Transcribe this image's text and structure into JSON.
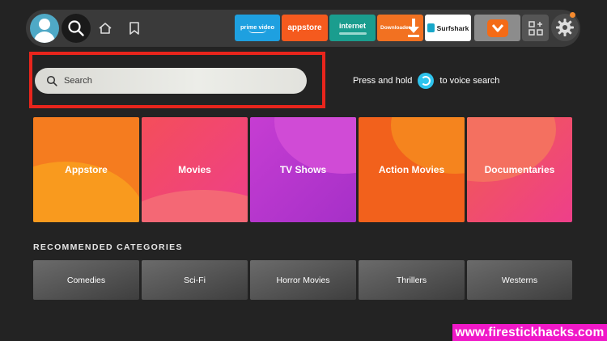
{
  "nav": {
    "apps": {
      "prime_video": "prime video",
      "appstore": "appstore",
      "internet": "internet",
      "downloader": "Downloader",
      "surfshark": "Surfshark"
    }
  },
  "search": {
    "placeholder": "Search"
  },
  "voice_hint": {
    "before": "Press and hold",
    "after": "to voice search"
  },
  "categories": [
    {
      "label": "Appstore"
    },
    {
      "label": "Movies"
    },
    {
      "label": "TV Shows"
    },
    {
      "label": "Action Movies"
    },
    {
      "label": "Documentaries"
    }
  ],
  "recommended": {
    "heading": "RECOMMENDED CATEGORIES",
    "items": [
      {
        "label": "Comedies"
      },
      {
        "label": "Sci-Fi"
      },
      {
        "label": "Horror Movies"
      },
      {
        "label": "Thrillers"
      },
      {
        "label": "Westerns"
      }
    ]
  },
  "watermark": "www.firestickhacks.com",
  "colors": {
    "background": "#232323",
    "highlight": "#e8251c",
    "alexa": "#2ec4ee",
    "watermark": "#f018c8"
  }
}
